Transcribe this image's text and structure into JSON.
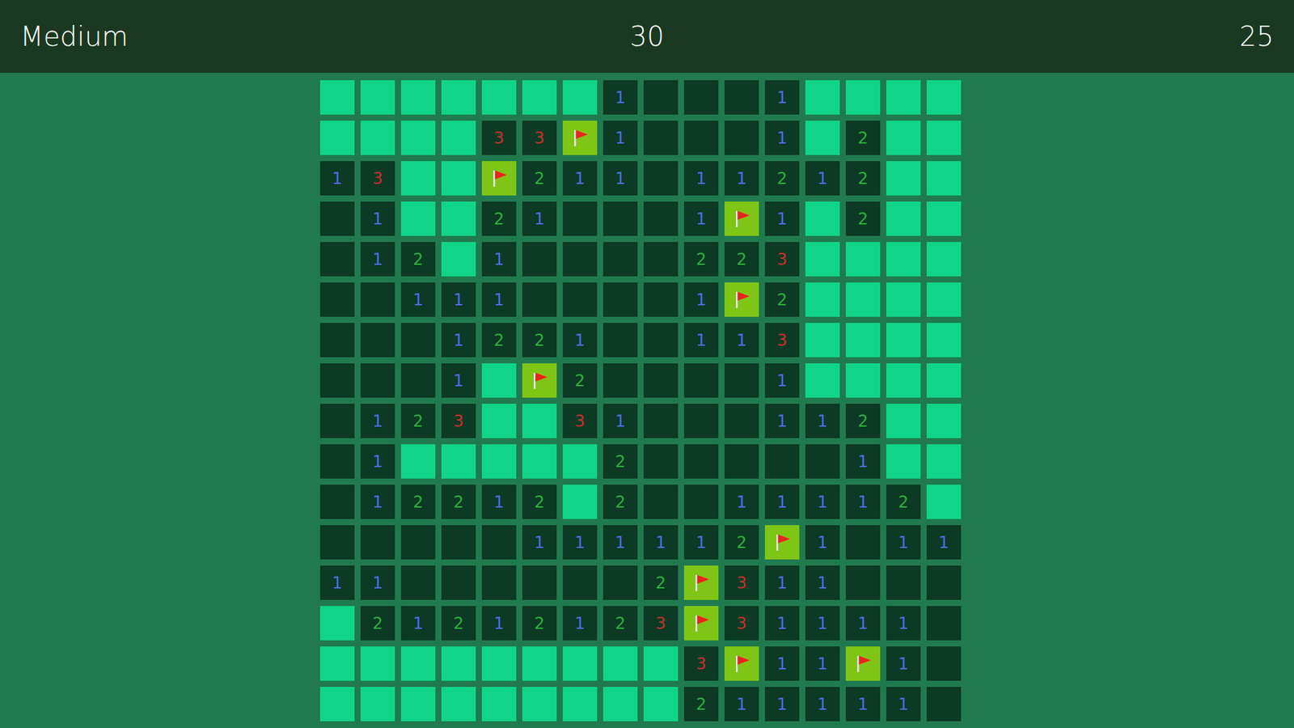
{
  "title": "Medium",
  "timer": "30",
  "mines": "25",
  "board": [
    [
      {
        "kind": "hidden"
      },
      {
        "kind": "hidden"
      },
      {
        "kind": "hidden"
      },
      {
        "kind": "hidden"
      },
      {
        "kind": "hidden"
      },
      {
        "kind": "hidden"
      },
      {
        "kind": "hidden"
      },
      {
        "kind": "number",
        "text": "1"
      },
      {
        "kind": "empty"
      },
      {
        "kind": "empty"
      },
      {
        "kind": "empty"
      },
      {
        "kind": "number",
        "text": "1"
      },
      {
        "kind": "hidden"
      },
      {
        "kind": "hidden"
      },
      {
        "kind": "hidden"
      },
      {
        "kind": "hidden"
      }
    ],
    [
      {
        "kind": "hidden"
      },
      {
        "kind": "hidden"
      },
      {
        "kind": "hidden"
      },
      {
        "kind": "hidden"
      },
      {
        "kind": "number",
        "text": "3"
      },
      {
        "kind": "number",
        "text": "3"
      },
      {
        "kind": "flag"
      },
      {
        "kind": "number",
        "text": "1"
      },
      {
        "kind": "empty"
      },
      {
        "kind": "empty"
      },
      {
        "kind": "empty"
      },
      {
        "kind": "number",
        "text": "1"
      },
      {
        "kind": "hidden"
      },
      {
        "kind": "number",
        "text": "2"
      },
      {
        "kind": "hidden"
      },
      {
        "kind": "hidden"
      }
    ],
    [
      {
        "kind": "number",
        "text": "1"
      },
      {
        "kind": "number",
        "text": "3"
      },
      {
        "kind": "hidden"
      },
      {
        "kind": "hidden"
      },
      {
        "kind": "flag"
      },
      {
        "kind": "number",
        "text": "2"
      },
      {
        "kind": "number",
        "text": "1"
      },
      {
        "kind": "number",
        "text": "1"
      },
      {
        "kind": "empty"
      },
      {
        "kind": "number",
        "text": "1"
      },
      {
        "kind": "number",
        "text": "1"
      },
      {
        "kind": "number",
        "text": "2"
      },
      {
        "kind": "number",
        "text": "1"
      },
      {
        "kind": "number",
        "text": "2"
      },
      {
        "kind": "hidden"
      },
      {
        "kind": "hidden"
      }
    ],
    [
      {
        "kind": "empty"
      },
      {
        "kind": "number",
        "text": "1"
      },
      {
        "kind": "hidden"
      },
      {
        "kind": "hidden"
      },
      {
        "kind": "number",
        "text": "2"
      },
      {
        "kind": "number",
        "text": "1"
      },
      {
        "kind": "empty"
      },
      {
        "kind": "empty"
      },
      {
        "kind": "empty"
      },
      {
        "kind": "number",
        "text": "1"
      },
      {
        "kind": "flag"
      },
      {
        "kind": "number",
        "text": "1"
      },
      {
        "kind": "hidden"
      },
      {
        "kind": "number",
        "text": "2"
      },
      {
        "kind": "hidden"
      },
      {
        "kind": "hidden"
      }
    ],
    [
      {
        "kind": "empty"
      },
      {
        "kind": "number",
        "text": "1"
      },
      {
        "kind": "number",
        "text": "2"
      },
      {
        "kind": "hidden"
      },
      {
        "kind": "number",
        "text": "1"
      },
      {
        "kind": "empty"
      },
      {
        "kind": "empty"
      },
      {
        "kind": "empty"
      },
      {
        "kind": "empty"
      },
      {
        "kind": "number",
        "text": "2"
      },
      {
        "kind": "number",
        "text": "2"
      },
      {
        "kind": "number",
        "text": "3"
      },
      {
        "kind": "hidden"
      },
      {
        "kind": "hidden"
      },
      {
        "kind": "hidden"
      },
      {
        "kind": "hidden"
      }
    ],
    [
      {
        "kind": "empty"
      },
      {
        "kind": "empty"
      },
      {
        "kind": "number",
        "text": "1"
      },
      {
        "kind": "number",
        "text": "1"
      },
      {
        "kind": "number",
        "text": "1"
      },
      {
        "kind": "empty"
      },
      {
        "kind": "empty"
      },
      {
        "kind": "empty"
      },
      {
        "kind": "empty"
      },
      {
        "kind": "number",
        "text": "1"
      },
      {
        "kind": "flag"
      },
      {
        "kind": "number",
        "text": "2"
      },
      {
        "kind": "hidden"
      },
      {
        "kind": "hidden"
      },
      {
        "kind": "hidden"
      },
      {
        "kind": "hidden"
      }
    ],
    [
      {
        "kind": "empty"
      },
      {
        "kind": "empty"
      },
      {
        "kind": "empty"
      },
      {
        "kind": "number",
        "text": "1"
      },
      {
        "kind": "number",
        "text": "2"
      },
      {
        "kind": "number",
        "text": "2"
      },
      {
        "kind": "number",
        "text": "1"
      },
      {
        "kind": "empty"
      },
      {
        "kind": "empty"
      },
      {
        "kind": "number",
        "text": "1"
      },
      {
        "kind": "number",
        "text": "1"
      },
      {
        "kind": "number",
        "text": "3"
      },
      {
        "kind": "hidden"
      },
      {
        "kind": "hidden"
      },
      {
        "kind": "hidden"
      },
      {
        "kind": "hidden"
      }
    ],
    [
      {
        "kind": "empty"
      },
      {
        "kind": "empty"
      },
      {
        "kind": "empty"
      },
      {
        "kind": "number",
        "text": "1"
      },
      {
        "kind": "hidden"
      },
      {
        "kind": "flag"
      },
      {
        "kind": "number",
        "text": "2"
      },
      {
        "kind": "empty"
      },
      {
        "kind": "empty"
      },
      {
        "kind": "empty"
      },
      {
        "kind": "empty"
      },
      {
        "kind": "number",
        "text": "1"
      },
      {
        "kind": "hidden"
      },
      {
        "kind": "hidden"
      },
      {
        "kind": "hidden"
      },
      {
        "kind": "hidden"
      }
    ],
    [
      {
        "kind": "empty"
      },
      {
        "kind": "number",
        "text": "1"
      },
      {
        "kind": "number",
        "text": "2"
      },
      {
        "kind": "number",
        "text": "3"
      },
      {
        "kind": "hidden"
      },
      {
        "kind": "hidden"
      },
      {
        "kind": "number",
        "text": "3"
      },
      {
        "kind": "number",
        "text": "1"
      },
      {
        "kind": "empty"
      },
      {
        "kind": "empty"
      },
      {
        "kind": "empty"
      },
      {
        "kind": "number",
        "text": "1"
      },
      {
        "kind": "number",
        "text": "1"
      },
      {
        "kind": "number",
        "text": "2"
      },
      {
        "kind": "hidden"
      },
      {
        "kind": "hidden"
      }
    ],
    [
      {
        "kind": "empty"
      },
      {
        "kind": "number",
        "text": "1"
      },
      {
        "kind": "hidden"
      },
      {
        "kind": "hidden"
      },
      {
        "kind": "hidden"
      },
      {
        "kind": "hidden"
      },
      {
        "kind": "hidden"
      },
      {
        "kind": "number",
        "text": "2"
      },
      {
        "kind": "empty"
      },
      {
        "kind": "empty"
      },
      {
        "kind": "empty"
      },
      {
        "kind": "empty"
      },
      {
        "kind": "empty"
      },
      {
        "kind": "number",
        "text": "1"
      },
      {
        "kind": "hidden"
      },
      {
        "kind": "hidden"
      }
    ],
    [
      {
        "kind": "empty"
      },
      {
        "kind": "number",
        "text": "1"
      },
      {
        "kind": "number",
        "text": "2"
      },
      {
        "kind": "number",
        "text": "2"
      },
      {
        "kind": "number",
        "text": "1"
      },
      {
        "kind": "number",
        "text": "2"
      },
      {
        "kind": "hidden"
      },
      {
        "kind": "number",
        "text": "2"
      },
      {
        "kind": "empty"
      },
      {
        "kind": "empty"
      },
      {
        "kind": "number",
        "text": "1"
      },
      {
        "kind": "number",
        "text": "1"
      },
      {
        "kind": "number",
        "text": "1"
      },
      {
        "kind": "number",
        "text": "1"
      },
      {
        "kind": "number",
        "text": "2"
      },
      {
        "kind": "hidden"
      }
    ],
    [
      {
        "kind": "empty"
      },
      {
        "kind": "empty"
      },
      {
        "kind": "empty"
      },
      {
        "kind": "empty"
      },
      {
        "kind": "empty"
      },
      {
        "kind": "number",
        "text": "1"
      },
      {
        "kind": "number",
        "text": "1"
      },
      {
        "kind": "number",
        "text": "1"
      },
      {
        "kind": "number",
        "text": "1"
      },
      {
        "kind": "number",
        "text": "1"
      },
      {
        "kind": "number",
        "text": "2"
      },
      {
        "kind": "flag"
      },
      {
        "kind": "number",
        "text": "1"
      },
      {
        "kind": "empty"
      },
      {
        "kind": "number",
        "text": "1"
      },
      {
        "kind": "number",
        "text": "1"
      }
    ],
    [
      {
        "kind": "number",
        "text": "1"
      },
      {
        "kind": "number",
        "text": "1"
      },
      {
        "kind": "empty"
      },
      {
        "kind": "empty"
      },
      {
        "kind": "empty"
      },
      {
        "kind": "empty"
      },
      {
        "kind": "empty"
      },
      {
        "kind": "empty"
      },
      {
        "kind": "number",
        "text": "2"
      },
      {
        "kind": "flag"
      },
      {
        "kind": "number",
        "text": "3"
      },
      {
        "kind": "number",
        "text": "1"
      },
      {
        "kind": "number",
        "text": "1"
      },
      {
        "kind": "empty"
      },
      {
        "kind": "empty"
      },
      {
        "kind": "empty"
      }
    ],
    [
      {
        "kind": "hidden"
      },
      {
        "kind": "number",
        "text": "2"
      },
      {
        "kind": "number",
        "text": "1"
      },
      {
        "kind": "number",
        "text": "2"
      },
      {
        "kind": "number",
        "text": "1"
      },
      {
        "kind": "number",
        "text": "2"
      },
      {
        "kind": "number",
        "text": "1"
      },
      {
        "kind": "number",
        "text": "2"
      },
      {
        "kind": "number",
        "text": "3"
      },
      {
        "kind": "flag"
      },
      {
        "kind": "number",
        "text": "3"
      },
      {
        "kind": "number",
        "text": "1"
      },
      {
        "kind": "number",
        "text": "1"
      },
      {
        "kind": "number",
        "text": "1"
      },
      {
        "kind": "number",
        "text": "1"
      },
      {
        "kind": "empty"
      }
    ],
    [
      {
        "kind": "hidden"
      },
      {
        "kind": "hidden"
      },
      {
        "kind": "hidden"
      },
      {
        "kind": "hidden"
      },
      {
        "kind": "hidden"
      },
      {
        "kind": "hidden"
      },
      {
        "kind": "hidden"
      },
      {
        "kind": "hidden"
      },
      {
        "kind": "hidden"
      },
      {
        "kind": "number",
        "text": "3"
      },
      {
        "kind": "flag"
      },
      {
        "kind": "number",
        "text": "1"
      },
      {
        "kind": "number",
        "text": "1"
      },
      {
        "kind": "flag"
      },
      {
        "kind": "number",
        "text": "1"
      },
      {
        "kind": "empty"
      }
    ],
    [
      {
        "kind": "hidden"
      },
      {
        "kind": "hidden"
      },
      {
        "kind": "hidden"
      },
      {
        "kind": "hidden"
      },
      {
        "kind": "hidden"
      },
      {
        "kind": "hidden"
      },
      {
        "kind": "hidden"
      },
      {
        "kind": "hidden"
      },
      {
        "kind": "hidden"
      },
      {
        "kind": "number",
        "text": "2"
      },
      {
        "kind": "number",
        "text": "1"
      },
      {
        "kind": "number",
        "text": "1"
      },
      {
        "kind": "number",
        "text": "1"
      },
      {
        "kind": "number",
        "text": "1"
      },
      {
        "kind": "number",
        "text": "1"
      },
      {
        "kind": "empty"
      }
    ]
  ]
}
